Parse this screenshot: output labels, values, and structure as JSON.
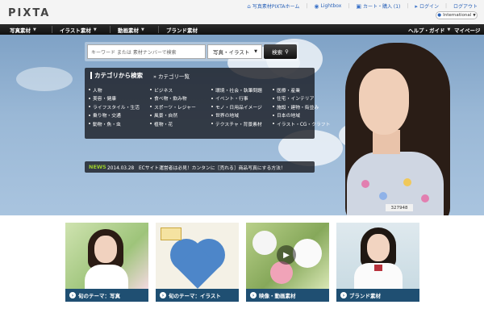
{
  "header": {
    "logo": "PIXTA",
    "links": [
      {
        "label": "写真素材PIXTAホーム",
        "icon": "house-icon"
      },
      {
        "label": "Lightbox",
        "icon": "lightbox-icon"
      },
      {
        "label": "カート・購入 (1)",
        "icon": "cart-icon"
      },
      {
        "label": "ログイン",
        "icon": "login-icon"
      },
      {
        "label": "ログアウト",
        "icon": ""
      }
    ],
    "language": "International"
  },
  "nav": {
    "items": [
      "写真素材",
      "イラスト素材",
      "動画素材",
      "ブランド素材"
    ],
    "right_items": [
      "ヘルプ・ガイド",
      "マイページ"
    ]
  },
  "search": {
    "placeholder": "キーワード または 素材ナンバーで検索",
    "type_selected": "写真・イラスト",
    "button_label": "検索"
  },
  "categories": {
    "title": "カテゴリから検索",
    "all_link": "» カテゴリ一覧",
    "columns": [
      [
        "人物",
        "美容・健康",
        "ライフスタイル・生活",
        "乗り物・交通",
        "動物・魚・虫"
      ],
      [
        "ビジネス",
        "食べ物・飲み物",
        "スポーツ・レジャー",
        "風景・自然",
        "植物・花"
      ],
      [
        "環境・社会・執筆問題",
        "イベント・行事",
        "モノ・日用品イメージ",
        "世界の地域",
        "テクスチャ・背景素材"
      ],
      [
        "医療・産業",
        "住宅・インテリア",
        "施設・建物・街並み",
        "日本の地域",
        "イラスト・CG・クラフト"
      ]
    ]
  },
  "news": {
    "tag": "NEWS",
    "text": "2014.03.28　ECサイト運営者は必見！カンタンに［売れる］商品写真にする方法！"
  },
  "hero": {
    "image_id": "327948"
  },
  "tiles": [
    {
      "label": "旬のテーマ：写真"
    },
    {
      "label": "旬のテーマ：イラスト"
    },
    {
      "label": "映像・動画素材"
    },
    {
      "label": "ブランド素材"
    }
  ],
  "colors": {
    "nav_bg": "#1a1a1a",
    "tile_label_bg": "#1f4f72",
    "news_tag": "#9ccf2d",
    "link": "#2a62b8"
  }
}
